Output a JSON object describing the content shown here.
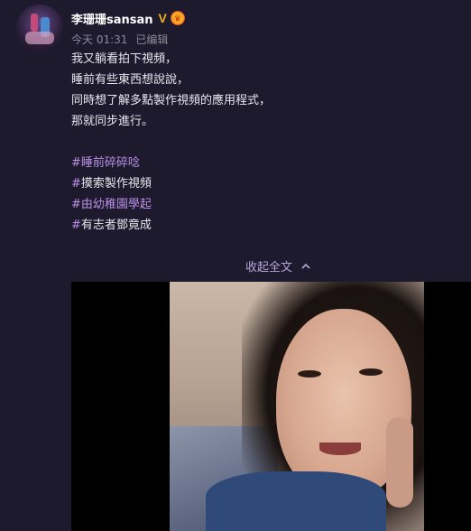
{
  "author": {
    "name": "李珊珊sansan",
    "verified_icon": "verified-v-icon",
    "badge_icon": "member-crown-icon",
    "verified_color": "#f2b11a"
  },
  "meta": {
    "time": "今天 01:31",
    "edited": "已编辑"
  },
  "post": {
    "lines": [
      "我又躺看拍下視頻，",
      "睡前有些東西想說說，",
      "同時想了解多點製作視頻的應用程式，",
      "那就同步進行。"
    ],
    "tags": [
      {
        "hash": "#",
        "text": "睡前碎碎唸",
        "style": "purple"
      },
      {
        "hash": "#",
        "text": "摸索製作視頻",
        "style": "white"
      },
      {
        "hash": "#",
        "text": "由幼稚園學起",
        "style": "purple"
      },
      {
        "hash": "#",
        "text": "有志者鄧竟成",
        "style": "white"
      }
    ],
    "tag_color": "#b98fe6"
  },
  "collapse": {
    "label": "收起全文",
    "icon": "chevron-up-icon"
  },
  "video": {
    "thumbnail": "video-thumbnail"
  }
}
